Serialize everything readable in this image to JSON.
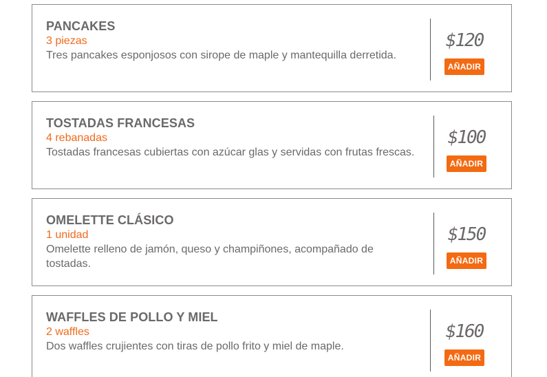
{
  "items": [
    {
      "name": "PANCAKES",
      "quantity": "3 piezas",
      "description": "Tres pancakes esponjosos con sirope de maple y mantequilla derretida.",
      "price": "$120",
      "add_label": "AÑADIR"
    },
    {
      "name": "TOSTADAS FRANCESAS",
      "quantity": "4 rebanadas",
      "description": "Tostadas francesas cubiertas con azúcar glas y servidas con frutas frescas.",
      "price": "$100",
      "add_label": "AÑADIR"
    },
    {
      "name": "OMELETTE CLÁSICO",
      "quantity": "1 unidad",
      "description": "Omelette relleno de jamón, queso y champiñones, acompañado de tostadas.",
      "price": "$150",
      "add_label": "AÑADIR"
    },
    {
      "name": "WAFFLES DE POLLO Y MIEL",
      "quantity": "2 waffles",
      "description": "Dos waffles crujientes con tiras de pollo frito y miel de maple.",
      "price": "$160",
      "add_label": "AÑADIR"
    }
  ],
  "colors": {
    "accent": "#f36a12",
    "text": "#6b6868",
    "border": "#8a8a8a"
  }
}
